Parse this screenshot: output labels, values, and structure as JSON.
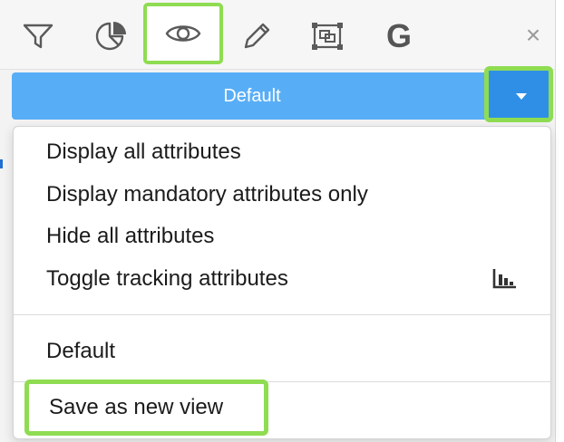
{
  "toolbar": {
    "tools": [
      {
        "name": "filter",
        "icon": "filter-icon"
      },
      {
        "name": "chart",
        "icon": "pie-chart-icon"
      },
      {
        "name": "view",
        "icon": "eye-icon",
        "active": true
      },
      {
        "name": "edit",
        "icon": "pencil-icon"
      },
      {
        "name": "layout",
        "icon": "frame-icon"
      },
      {
        "name": "google",
        "icon": "google-g-icon",
        "glyph": "G"
      },
      {
        "name": "close",
        "icon": "close-icon",
        "glyph": "×"
      }
    ]
  },
  "view_selector": {
    "label": "Default",
    "dropdown_icon": "caret-down-icon",
    "button_color": "#58aef6",
    "caret_color": "#2f8fe6"
  },
  "menu": {
    "items": [
      "Display all attributes",
      "Display mandatory attributes only",
      "Hide all attributes",
      "Toggle tracking attributes"
    ],
    "tracking_icon": "bar-chart-icon",
    "views": [
      "Default"
    ],
    "save_label": "Save as new view"
  },
  "highlight_color": "#8fdc52"
}
